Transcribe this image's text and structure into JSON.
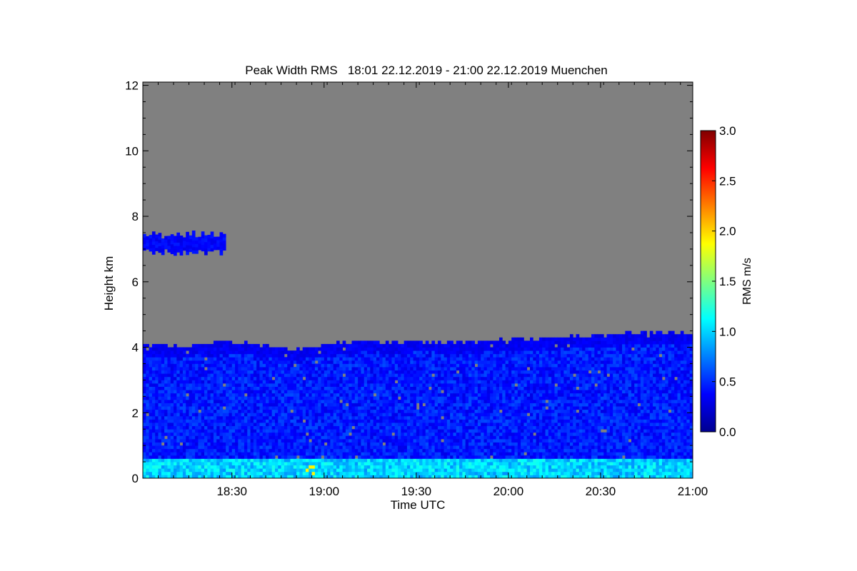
{
  "chart_data": {
    "type": "heatmap",
    "title": "Peak Width RMS   18:01 22.12.2019 - 21:00 22.12.2019 Muenchen",
    "xlabel": "Time UTC",
    "ylabel": "Height km",
    "x_start": "18:01",
    "x_end": "21:00",
    "xlim_minutes_utc": [
      1081,
      1260
    ],
    "x_ticks": [
      {
        "minute": 1110,
        "label": "18:30"
      },
      {
        "minute": 1140,
        "label": "19:00"
      },
      {
        "minute": 1170,
        "label": "19:30"
      },
      {
        "minute": 1200,
        "label": "20:00"
      },
      {
        "minute": 1230,
        "label": "20:30"
      },
      {
        "minute": 1260,
        "label": "21:00"
      }
    ],
    "ylim_km": [
      0,
      12.1
    ],
    "y_ticks": [
      {
        "value": 0,
        "label": "0"
      },
      {
        "value": 2,
        "label": "2"
      },
      {
        "value": 4,
        "label": "4"
      },
      {
        "value": 6,
        "label": "6"
      },
      {
        "value": 8,
        "label": "8"
      },
      {
        "value": 10,
        "label": "10"
      },
      {
        "value": 12,
        "label": "12"
      }
    ],
    "colorbar": {
      "label": "RMS m/s",
      "range": [
        0.0,
        3.0
      ],
      "ticks": [
        "0.0",
        "0.5",
        "1.0",
        "1.5",
        "2.0",
        "2.5",
        "3.0"
      ],
      "colormap": "jet"
    },
    "no_data_color": "#808080",
    "background_color": "#808080",
    "cloud_top_km": [
      [
        1081,
        4.05
      ],
      [
        1090,
        3.95
      ],
      [
        1100,
        4.05
      ],
      [
        1110,
        4.1
      ],
      [
        1120,
        4.0
      ],
      [
        1130,
        3.85
      ],
      [
        1140,
        4.05
      ],
      [
        1150,
        4.15
      ],
      [
        1160,
        4.1
      ],
      [
        1170,
        4.15
      ],
      [
        1180,
        4.1
      ],
      [
        1190,
        4.15
      ],
      [
        1200,
        4.2
      ],
      [
        1210,
        4.2
      ],
      [
        1220,
        4.3
      ],
      [
        1230,
        4.3
      ],
      [
        1240,
        4.4
      ],
      [
        1250,
        4.4
      ],
      [
        1260,
        4.35
      ]
    ],
    "upper_layer": {
      "start": 1081,
      "end": 1108,
      "bottom_km": 6.9,
      "top_km": 7.4
    },
    "surface_band_km": [
      0,
      0.6
    ],
    "typical_value_main": 0.45,
    "typical_value_surface": 1.0
  }
}
